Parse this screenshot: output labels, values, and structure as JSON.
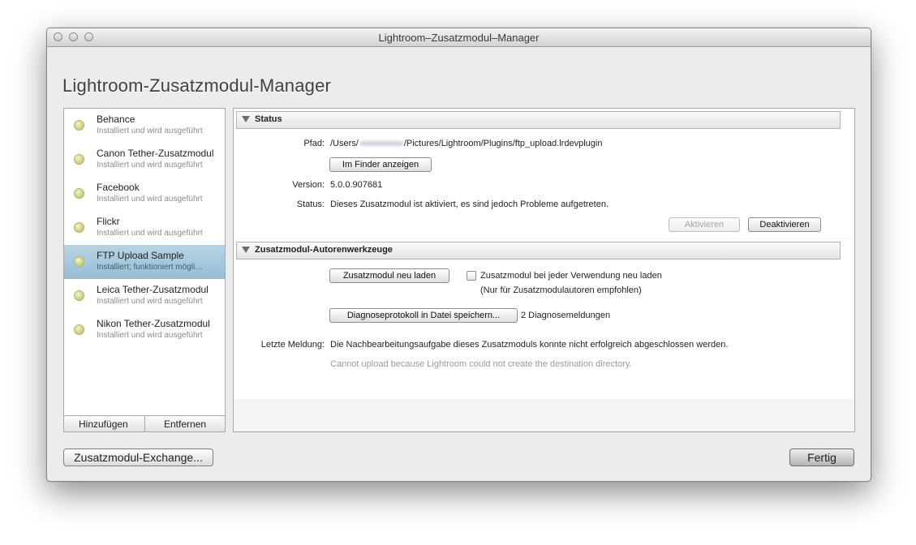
{
  "window": {
    "title": "Lightroom–Zusatzmodul–Manager"
  },
  "app_title": "Lightroom-Zusatzmodul-Manager",
  "plugins": [
    {
      "name": "Behance",
      "status": "Installiert und wird ausgeführt"
    },
    {
      "name": "Canon Tether-Zusatzmodul",
      "status": "Installiert und wird ausgeführt"
    },
    {
      "name": "Facebook",
      "status": "Installiert und wird ausgeführt"
    },
    {
      "name": "Flickr",
      "status": "Installiert und wird ausgeführt"
    },
    {
      "name": "FTP Upload Sample",
      "status": "Installiert; funktioniert mögli…",
      "selected": true
    },
    {
      "name": "Leica Tether-Zusatzmodul",
      "status": "Installiert und wird ausgeführt"
    },
    {
      "name": "Nikon Tether-Zusatzmodul",
      "status": "Installiert und wird ausgeführt"
    }
  ],
  "list_buttons": {
    "add": "Hinzufügen",
    "remove": "Entfernen"
  },
  "status_section": {
    "title": "Status",
    "path_label": "Pfad:",
    "path_prefix": "/Users/",
    "path_suffix": "/Pictures/Lightroom/Plugins/ftp_upload.lrdevplugin",
    "show_in_finder": "Im Finder anzeigen",
    "version_label": "Version:",
    "version": "5.0.0.907681",
    "status_label": "Status:",
    "status_text": "Dieses Zusatzmodul ist aktiviert, es sind jedoch Probleme aufgetreten.",
    "enable_button": "Aktivieren",
    "disable_button": "Deaktivieren"
  },
  "tools_section": {
    "title": "Zusatzmodul-Autorenwerkzeuge",
    "reload_button": "Zusatzmodul neu laden",
    "reload_each_use_label": "Zusatzmodul bei jeder Verwendung neu laden",
    "reload_hint": "(Nur für Zusatzmodulautoren empfohlen)",
    "save_log_button": "Diagnoseprotokoll in Datei speichern...",
    "diag_count": "2 Diagnosemeldungen",
    "last_message_label": "Letzte Meldung:",
    "last_message": "Die Nachbearbeitungsaufgabe dieses Zusatzmoduls konnte nicht erfolgreich abgeschlossen werden.",
    "last_message_detail": "Cannot upload because Lightroom could not create the destination directory."
  },
  "footer": {
    "exchange_button": "Zusatzmodul-Exchange...",
    "done_button": "Fertig"
  }
}
